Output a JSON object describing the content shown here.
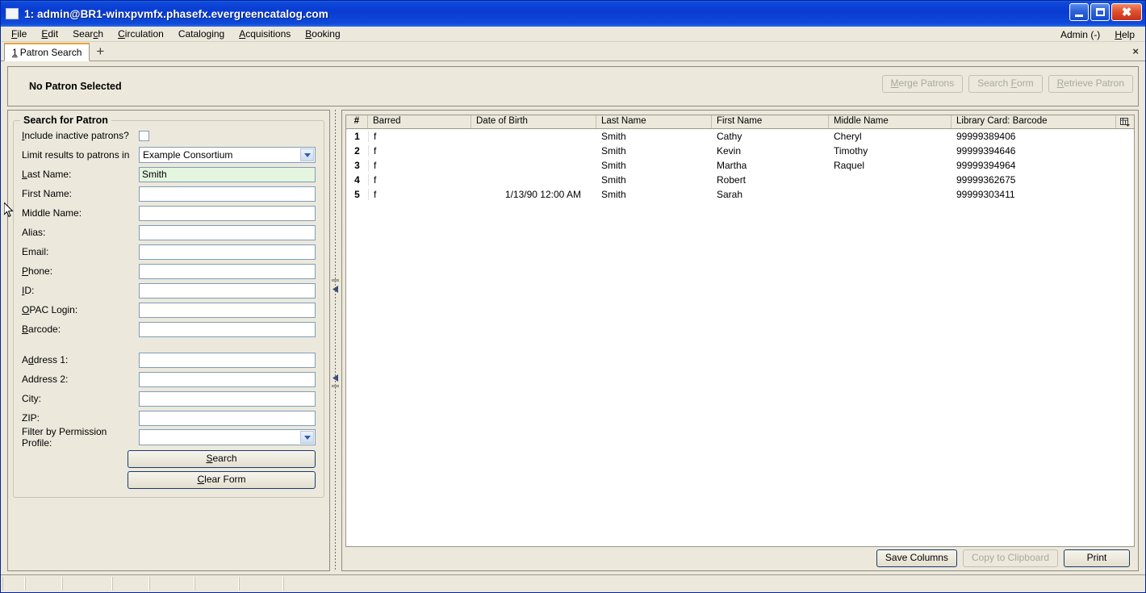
{
  "window": {
    "title": "1: admin@BR1-winxpvmfx.phasefx.evergreencatalog.com",
    "minimize_label": "Minimize",
    "maximize_label": "Maximize",
    "close_label": "Close"
  },
  "menubar": {
    "items": [
      {
        "label": "File",
        "accel": "F"
      },
      {
        "label": "Edit",
        "accel": "E"
      },
      {
        "label": "Search",
        "accel": "c"
      },
      {
        "label": "Circulation",
        "accel": "C"
      },
      {
        "label": "Cataloging",
        "accel": "g"
      },
      {
        "label": "Acquisitions",
        "accel": "A"
      },
      {
        "label": "Booking",
        "accel": "B"
      }
    ],
    "right_items": [
      {
        "label": "Admin (-)"
      },
      {
        "label": "Help"
      }
    ]
  },
  "tabstrip": {
    "tabs": [
      {
        "num": "1",
        "label": "Patron Search",
        "active": true
      }
    ],
    "new_tab_label": "+",
    "close_label": "×"
  },
  "patron_bar": {
    "title": "No Patron Selected",
    "actions": [
      {
        "label": "Merge Patrons",
        "disabled": true
      },
      {
        "label": "Search Form",
        "disabled": true
      },
      {
        "label": "Retrieve Patron",
        "disabled": true
      }
    ]
  },
  "search_form": {
    "legend": "Search for Patron",
    "include_inactive_label": "Include inactive patrons?",
    "include_inactive_checked": false,
    "limit_results_label": "Limit results to patrons in",
    "limit_results_value": "Example Consortium",
    "fields": [
      {
        "label": "Last Name:",
        "value": "Smith",
        "focused": true
      },
      {
        "label": "First Name:",
        "value": "",
        "focused": false
      },
      {
        "label": "Middle Name:",
        "value": "",
        "focused": false
      },
      {
        "label": "Alias:",
        "value": "",
        "focused": false
      },
      {
        "label": "Email:",
        "value": "",
        "focused": false
      },
      {
        "label": "Phone:",
        "value": "",
        "focused": false
      },
      {
        "label": "ID:",
        "value": "",
        "focused": false
      },
      {
        "label": "OPAC Login:",
        "value": "",
        "focused": false
      },
      {
        "label": "Barcode:",
        "value": "",
        "focused": false
      }
    ],
    "address_fields": [
      {
        "label": "Address 1:",
        "value": ""
      },
      {
        "label": "Address 2:",
        "value": ""
      },
      {
        "label": "City:",
        "value": ""
      },
      {
        "label": "ZIP:",
        "value": ""
      }
    ],
    "permission_profile_label": "Filter by Permission Profile:",
    "permission_profile_value": "",
    "search_button": "Search",
    "clear_button": "Clear Form"
  },
  "results": {
    "columns": [
      {
        "key": "num",
        "label": "#"
      },
      {
        "key": "barred",
        "label": "Barred"
      },
      {
        "key": "dob",
        "label": "Date of Birth"
      },
      {
        "key": "last",
        "label": "Last Name"
      },
      {
        "key": "first",
        "label": "First Name"
      },
      {
        "key": "middle",
        "label": "Middle Name"
      },
      {
        "key": "card",
        "label": "Library Card: Barcode"
      }
    ],
    "column_picker_name": "column-picker-icon",
    "rows": [
      {
        "num": "1",
        "barred": "f",
        "dob": "",
        "last": "Smith",
        "first": "Cathy",
        "middle": "Cheryl",
        "card": "99999389406"
      },
      {
        "num": "2",
        "barred": "f",
        "dob": "",
        "last": "Smith",
        "first": "Kevin",
        "middle": "Timothy",
        "card": "99999394646"
      },
      {
        "num": "3",
        "barred": "f",
        "dob": "",
        "last": "Smith",
        "first": "Martha",
        "middle": "Raquel",
        "card": "99999394964"
      },
      {
        "num": "4",
        "barred": "f",
        "dob": "",
        "last": "Smith",
        "first": "Robert",
        "middle": "",
        "card": "99999362675"
      },
      {
        "num": "5",
        "barred": "f",
        "dob": "1/13/90 12:00 AM",
        "last": "Smith",
        "first": "Sarah",
        "middle": "",
        "card": "99999303411"
      }
    ],
    "footer_buttons": [
      {
        "label": "Save Columns",
        "disabled": false
      },
      {
        "label": "Copy to Clipboard",
        "disabled": true
      },
      {
        "label": "Print",
        "disabled": false
      }
    ]
  },
  "statusbar": {
    "cells": [
      "",
      "",
      "",
      "",
      "",
      "",
      "",
      ""
    ]
  },
  "colors": {
    "title_bar_blue": "#0a3bd2",
    "window_bg": "#ece9dc",
    "field_focus_green": "#e4f5e0",
    "field_border": "#7f9db9",
    "active_tab_accent": "#e8a33d",
    "default_button_border": "#1b3a6b"
  }
}
